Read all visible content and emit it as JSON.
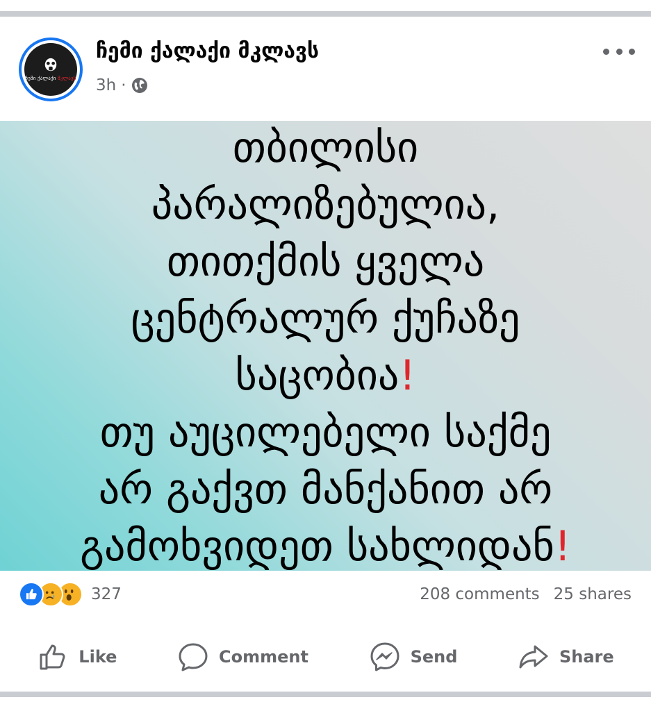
{
  "post": {
    "page_name": "ჩემი ქალაქი მკლავს",
    "timestamp": "3h",
    "separator": "·",
    "privacy_icon": "globe-icon",
    "more_icon": "more-horizontal-icon",
    "avatar": {
      "logo_text_white": "ჩემი ქალაქი",
      "logo_text_red": "მკლავს",
      "logo_icon": "gas-mask-icon"
    },
    "image_text_lines": [
      "თბილისი",
      "პარალიზებულია,",
      "თითქმის ყველა",
      "ცენტრალურ ქუჩაზე",
      "საცობია❗",
      "თუ აუცილებელი საქმე",
      "არ გაქვთ მანქანით არ",
      "გამოხვიდეთ სახლიდან❗"
    ]
  },
  "stats": {
    "reaction_icons": [
      "like-reaction-icon",
      "sad-reaction-icon",
      "wow-reaction-icon"
    ],
    "reaction_count": "327",
    "comments": "208 comments",
    "shares": "25 shares"
  },
  "actions": {
    "like": "Like",
    "comment": "Comment",
    "send": "Send",
    "share": "Share"
  },
  "colors": {
    "accent": "#1877f2",
    "meta_text": "#65676b",
    "separator": "#c9ccd1",
    "exclamation": "#e0262c",
    "gradient_teal": "#6fd2d4",
    "gradient_gray": "#dedede"
  }
}
